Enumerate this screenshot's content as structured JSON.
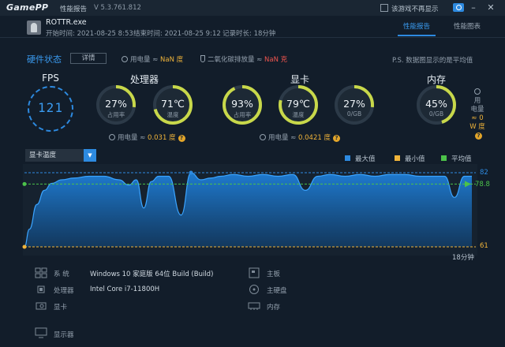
{
  "titlebar": {
    "logo": "GamePP",
    "section": "性能报告",
    "version": "V 5.3.761.812",
    "no_remind_label": "该游戏不再显示"
  },
  "header": {
    "game_name": "ROTTR.exe",
    "start_time": "开始时间: 2021-08-25 8:53",
    "end_time": "结束时间: 2021-08-25 9:12",
    "record_time": "记录时长: 18分钟",
    "tabs": [
      "性能报告",
      "性能图表"
    ],
    "active_tab": 0
  },
  "status": {
    "title": "硬件状态",
    "detail_button": "详情",
    "power_label": "用电量 ≈",
    "power_value": "NaN 度",
    "co2_label": "二氧化碳排放量 ≈",
    "co2_value": "NaN 克",
    "note": "P.S. 数据图显示的是平均值"
  },
  "fps": {
    "title": "FPS",
    "value": "121"
  },
  "cpu": {
    "title": "处理器",
    "usage": {
      "value": "27%",
      "label": "占用率",
      "level": 27
    },
    "temp": {
      "value": "71℃",
      "label": "温度",
      "level": 71
    },
    "power_label": "用电量 ≈",
    "power_value": "0.031 度"
  },
  "gpu": {
    "title": "显卡",
    "usage": {
      "value": "93%",
      "label": "占用率",
      "level": 93
    },
    "temp": {
      "value": "79℃",
      "label": "温度",
      "level": 79
    },
    "vram": {
      "value": "27%",
      "label": "0/GB",
      "level": 27
    },
    "power_label": "用电量 ≈",
    "power_value": "0.0421 度"
  },
  "memory": {
    "title": "内存",
    "usage": {
      "value": "45%",
      "label": "0/GB",
      "level": 45
    },
    "power_l1": "用",
    "power_l2": "电量",
    "power_l3": "≈ 0",
    "power_l4": "W 度"
  },
  "chart": {
    "dropdown_value": "显卡温度",
    "legend": [
      {
        "label": "最大值",
        "color": "#2d8ae0"
      },
      {
        "label": "最小值",
        "color": "#f0b43a"
      },
      {
        "label": "平均值",
        "color": "#4cc24a"
      }
    ],
    "max_label": "82",
    "avg_label": "78.8",
    "min_label": "61",
    "x_end_label": "18分钟"
  },
  "chart_data": {
    "type": "area",
    "title": "",
    "ylabel": "",
    "xlabel": "",
    "ylim": [
      61,
      82
    ],
    "xlim": [
      0,
      18
    ],
    "max": 82,
    "min": 61,
    "avg": 78.8,
    "series": [
      {
        "x": [
          0,
          0.2,
          0.5,
          0.8,
          1.1,
          1.5,
          2,
          2.6,
          3.2,
          3.8,
          4.2,
          4.5,
          4.8,
          5.1,
          5.4,
          5.8,
          6.3,
          6.7,
          7.1,
          7.5,
          7.9,
          8.4,
          9,
          9.6,
          10.2,
          10.8,
          11.3,
          11.8,
          12.3,
          12.9,
          13.5,
          14.1,
          14.7,
          15.3,
          15.9,
          16.5,
          16.9,
          17.3,
          17.7,
          18
        ],
        "values": [
          61,
          66,
          73,
          77,
          79,
          80,
          80.5,
          81,
          81,
          80,
          78.5,
          80,
          72,
          79.5,
          81,
          81,
          70,
          82,
          80,
          80.5,
          81,
          81.5,
          81,
          81.5,
          81,
          81.5,
          77,
          81,
          81.5,
          81,
          81.5,
          81,
          81.5,
          81.5,
          81,
          81,
          81,
          75,
          81,
          81
        ]
      }
    ]
  },
  "system": {
    "os_label": "系 统",
    "os_value": "Windows 10 家庭版 64位   Build (Build)",
    "cpu_label": "处理器",
    "cpu_value": "Intel Core i7-11800H",
    "gpu_label": "显卡",
    "monitor_label": "显示器",
    "board_label": "主板",
    "disk_label": "主硬盘",
    "ram_label": "内存"
  }
}
